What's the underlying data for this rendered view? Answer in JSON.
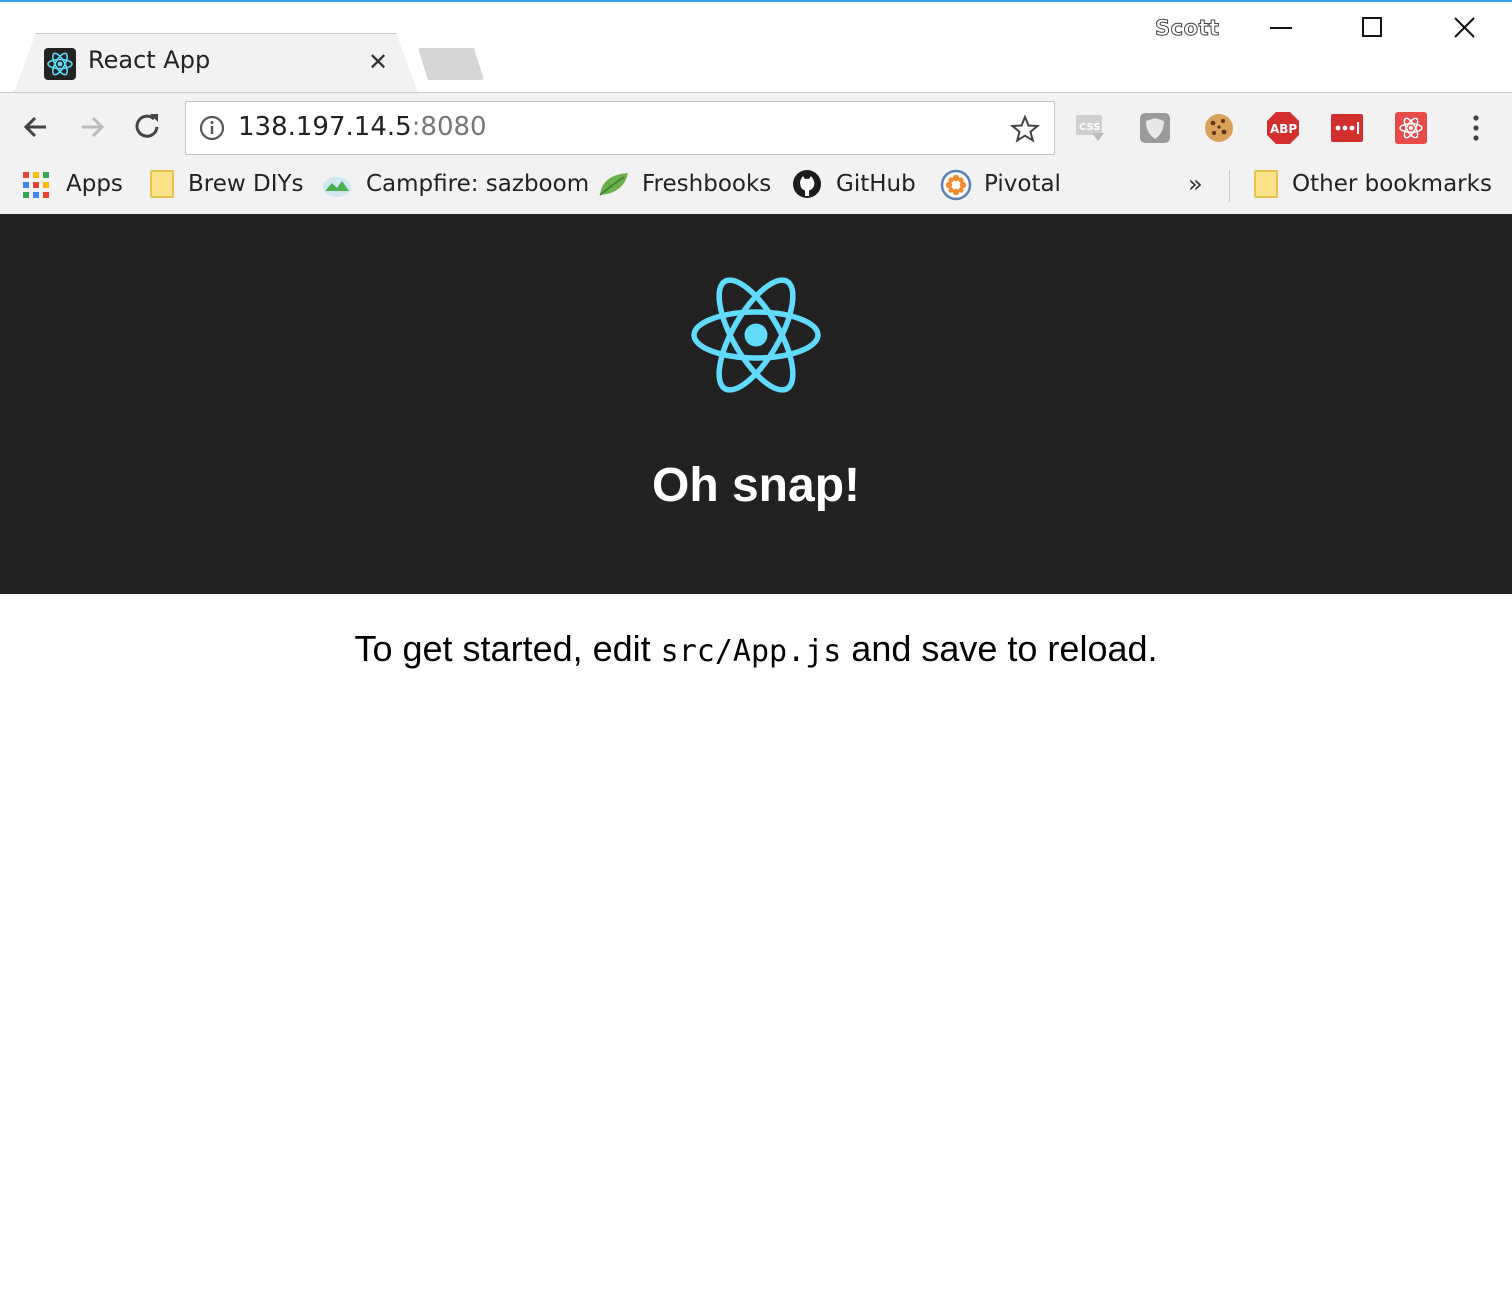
{
  "browser": {
    "profile_name": "Scott",
    "tab": {
      "title": "React App",
      "close_glyph": "✕"
    },
    "address_bar": {
      "host": "138.197.14.5",
      "port": ":8080"
    },
    "extensions": [
      "css-viewer-icon",
      "shield-extension-icon",
      "cookie-icon",
      "adblock-plus-icon",
      "lastpass-icon",
      "react-devtools-icon"
    ]
  },
  "bookmarks": {
    "items": [
      {
        "label": "Apps",
        "icon": "apps-grid-icon"
      },
      {
        "label": "Brew DIYs",
        "icon": "folder-icon"
      },
      {
        "label": "Campfire: sazboom",
        "icon": "campfire-icon"
      },
      {
        "label": "Freshbooks",
        "icon": "leaf-icon"
      },
      {
        "label": "GitHub",
        "icon": "github-icon"
      },
      {
        "label": "Pivotal",
        "icon": "pivotal-icon"
      }
    ],
    "overflow_glyph": "»",
    "other": "Other bookmarks"
  },
  "page": {
    "heading": "Oh snap!",
    "intro_before": "To get started, edit ",
    "intro_code": "src/App.js",
    "intro_after": " and save to reload.",
    "header_bg": "#222222",
    "logo_color": "#61dafb"
  }
}
